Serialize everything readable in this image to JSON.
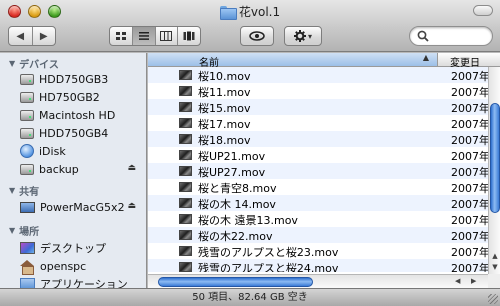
{
  "window": {
    "title": "花vol.1"
  },
  "toolbar": {
    "back_icon": "◀",
    "forward_icon": "▶",
    "action_caret": "▾"
  },
  "sidebar": {
    "sections": [
      {
        "header": "デバイス",
        "items": [
          {
            "label": "HDD750GB3",
            "icon": "hard-disk-icon"
          },
          {
            "label": "HD750GB2",
            "icon": "hard-disk-icon"
          },
          {
            "label": "Macintosh HD",
            "icon": "hard-disk-icon"
          },
          {
            "label": "HDD750GB4",
            "icon": "hard-disk-icon"
          },
          {
            "label": "iDisk",
            "icon": "idisk-icon"
          },
          {
            "label": "backup",
            "icon": "hard-disk-icon",
            "eject": "⏏"
          }
        ]
      },
      {
        "header": "共有",
        "items": [
          {
            "label": "PowerMacG5x2",
            "icon": "monitor-icon",
            "eject": "⏏"
          }
        ]
      },
      {
        "header": "場所",
        "items": [
          {
            "label": "デスクトップ",
            "icon": "desktop-icon"
          },
          {
            "label": "openspc",
            "icon": "home-icon"
          },
          {
            "label": "アプリケーション",
            "icon": "applications-icon"
          }
        ]
      }
    ]
  },
  "list": {
    "columns": {
      "name": "名前",
      "sort_indicator": "▲",
      "date": "変更日"
    },
    "rows": [
      {
        "name": "桜10.mov",
        "date": "2007年"
      },
      {
        "name": "桜11.mov",
        "date": "2007年"
      },
      {
        "name": "桜15.mov",
        "date": "2007年"
      },
      {
        "name": "桜17.mov",
        "date": "2007年"
      },
      {
        "name": "桜18.mov",
        "date": "2007年"
      },
      {
        "name": "桜UP21.mov",
        "date": "2007年"
      },
      {
        "name": "桜UP27.mov",
        "date": "2007年"
      },
      {
        "name": "桜と青空8.mov",
        "date": "2007年"
      },
      {
        "name": "桜の木 14.mov",
        "date": "2007年"
      },
      {
        "name": "桜の木 遠景13.mov",
        "date": "2007年"
      },
      {
        "name": "桜の木22.mov",
        "date": "2007年"
      },
      {
        "name": "残雪のアルプスと桜23.mov",
        "date": "2007年"
      },
      {
        "name": "残雪のアルプスと桜24.mov",
        "date": "2007年"
      }
    ]
  },
  "status": {
    "text": "50 項目、82.64 GB 空き"
  }
}
